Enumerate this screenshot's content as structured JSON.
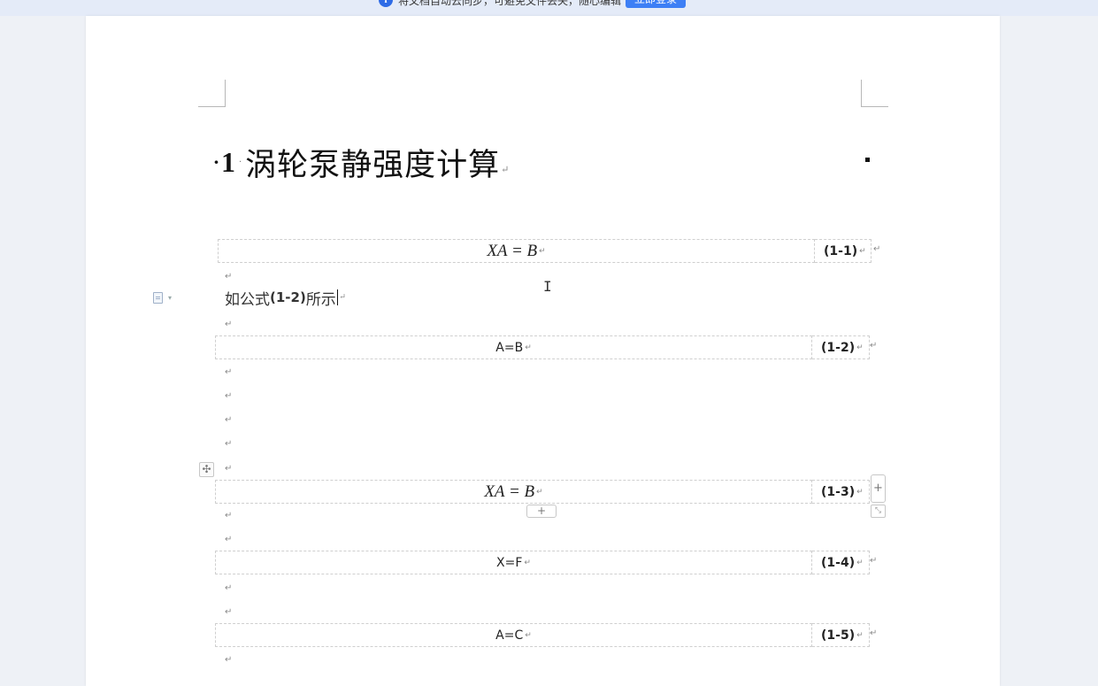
{
  "notice": {
    "text": "将文档自动云同步，可避免文件丢失，随心编辑",
    "info_icon": "i",
    "login_button": "立即登录"
  },
  "heading": {
    "bullet": "·",
    "number": "1",
    "space_mark": "·",
    "title": "涡轮泵静强度计算",
    "para_mark": "↵"
  },
  "paragraph_mark": "↵",
  "ibeam": "I",
  "body_text": {
    "before": "如公式",
    "ref": "(1-2)",
    "after": "所示"
  },
  "equations": [
    {
      "formula": "XA = B",
      "number": "(1-1)",
      "style": "math"
    },
    {
      "formula": "A=B",
      "number": "(1-2)",
      "style": "plain"
    },
    {
      "formula": "XA = B",
      "number": "(1-3)",
      "style": "math"
    },
    {
      "formula": "X=F",
      "number": "(1-4)",
      "style": "plain"
    },
    {
      "formula": "A=C",
      "number": "(1-5)",
      "style": "plain"
    }
  ],
  "table_controls": {
    "move_icon": "✣",
    "add_icon": "+",
    "resize_icon": "⤡"
  }
}
